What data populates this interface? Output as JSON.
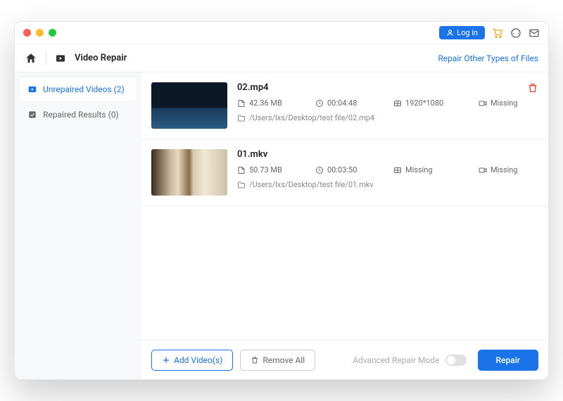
{
  "titlebar": {
    "login": "Log in"
  },
  "header": {
    "title": "Video Repair",
    "link": "Repair Other Types of Files"
  },
  "sidebar": {
    "items": [
      {
        "label": "Unrepaired Videos (2)"
      },
      {
        "label": "Repaired Results (0)"
      }
    ]
  },
  "files": [
    {
      "name": "02.mp4",
      "size": "42.36 MB",
      "duration": "00:04:48",
      "resolution": "1920*1080",
      "camera": "Missing",
      "path": "/Users/lxs/Desktop/test file/02.mp4"
    },
    {
      "name": "01.mkv",
      "size": "50.73 MB",
      "duration": "00:03:50",
      "resolution": "Missing",
      "camera": "Missing",
      "path": "/Users/lxs/Desktop/test file/01.mkv"
    }
  ],
  "footer": {
    "add": "Add Video(s)",
    "remove": "Remove All",
    "advanced": "Advanced Repair Mode",
    "repair": "Repair"
  }
}
